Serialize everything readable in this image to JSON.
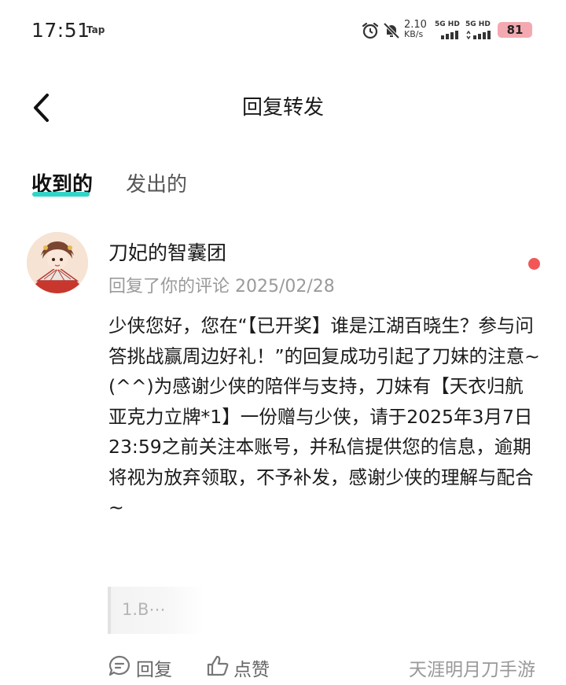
{
  "status_bar": {
    "time": "17:51",
    "tap_label": "Tap",
    "net_speed_value": "2.10",
    "net_speed_unit": "KB/s",
    "sim1": "5G HD",
    "sim2": "5G HD",
    "battery": "81",
    "icons": [
      "alarm-icon",
      "mute-icon",
      "signal-icon",
      "signal-icon"
    ]
  },
  "header": {
    "title": "回复转发",
    "back_icon": "chevron-left-icon"
  },
  "tabs": [
    {
      "label": "收到的",
      "active": true
    },
    {
      "label": "发出的",
      "active": false
    }
  ],
  "notification": {
    "sender": "刀妃的智囊团",
    "meta": "回复了你的评论 2025/02/28",
    "unread": true,
    "message": "少侠您好，您在“【已开奖】谁是江湖百晓生？参与问答挑战赢周边好礼！”的回复成功引起了刀妹的注意~(^^)为感谢少侠的陪伴与支持，刀妹有【天衣归航亚克力立牌*1】一份赠与少侠，请于2025年3月7日23:59之前关注本账号，并私信提供您的信息，逾期将视为放弃领取，不予补发，感谢少侠的理解与配合~",
    "quoted": "1.B⋯",
    "reply_label": "回复",
    "like_label": "点赞",
    "source": "天涯明月刀手游"
  },
  "colors": {
    "accent": "#30d5c8",
    "unread_dot": "#f25757",
    "battery_bg": "#f4a9b0",
    "meta_text": "#9a9a9a"
  }
}
